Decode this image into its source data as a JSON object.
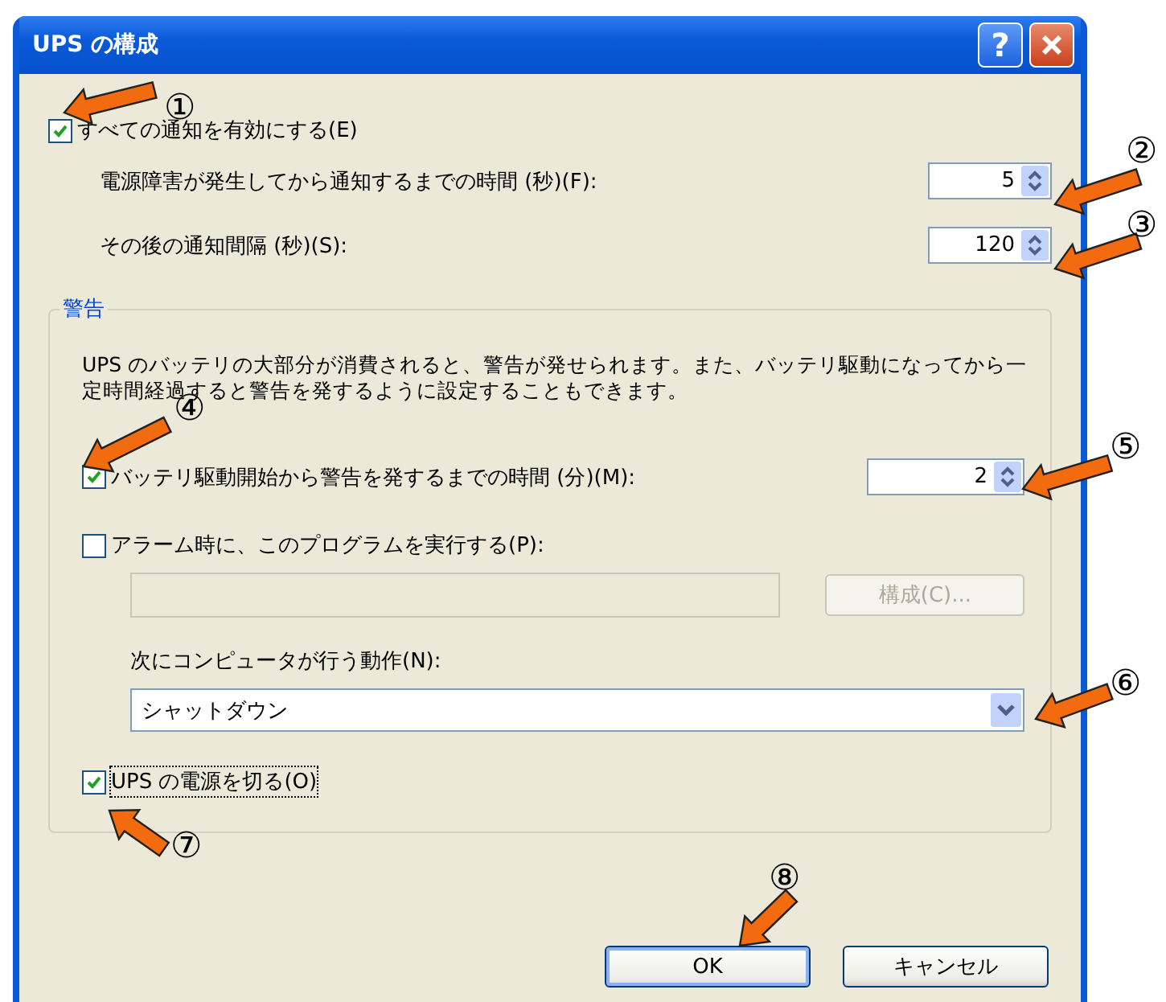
{
  "window": {
    "title": "UPS の構成",
    "help_label": "?"
  },
  "notifications": {
    "enable": {
      "label": "すべての通知を有効にする(E)",
      "checked": true
    },
    "fields": [
      {
        "label": "電源障害が発生してから通知するまでの時間 (秒)(F):",
        "value": "5"
      },
      {
        "label": "その後の通知間隔 (秒)(S):",
        "value": "120"
      }
    ]
  },
  "warning": {
    "legend": "警告",
    "description": "UPS のバッテリの大部分が消費されると、警告が発せられます。また、バッテリ駆動になってから一定時間経過すると警告を発するように設定することもできます。",
    "battery": {
      "label": "バッテリ駆動開始から警告を発するまでの時間 (分)(M):",
      "checked": true,
      "value": "2"
    },
    "program": {
      "label": "アラーム時に、このプログラムを実行する(P):",
      "checked": false,
      "field_disabled": true,
      "button": "構成(C)...",
      "button_disabled": true
    },
    "action": {
      "label": "次にコンピュータが行う動作(N):",
      "value": "シャットダウン"
    },
    "turn_off": {
      "label": "UPS の電源を切る(O)",
      "checked": true,
      "focused": true
    }
  },
  "buttons": [
    {
      "label": "OK",
      "default": true
    },
    {
      "label": "キャンセル",
      "default": false
    }
  ],
  "annotations": [
    {
      "number": "①"
    },
    {
      "number": "②"
    },
    {
      "number": "③"
    },
    {
      "number": "④"
    },
    {
      "number": "⑤"
    },
    {
      "number": "⑥"
    },
    {
      "number": "⑦"
    },
    {
      "number": "⑧"
    }
  ]
}
